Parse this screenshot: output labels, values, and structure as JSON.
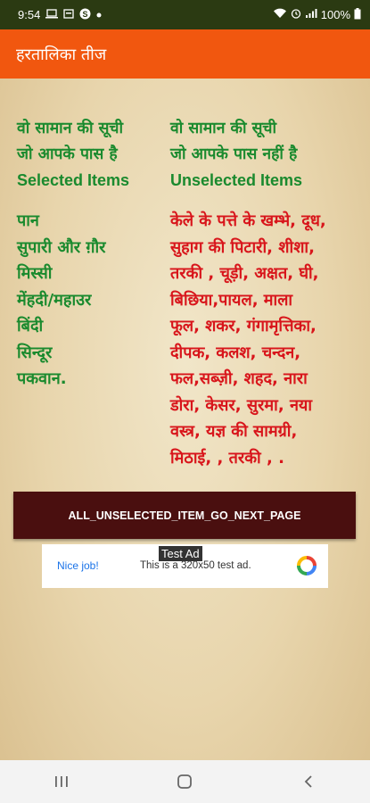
{
  "status_bar": {
    "time": "9:54",
    "battery": "100%",
    "icons": [
      "laptop-icon",
      "card-icon",
      "skype-icon",
      "dot-icon",
      "wifi-icon",
      "alarm-icon",
      "signal-icon",
      "battery-icon"
    ]
  },
  "app_bar": {
    "title": "हरतालिका तीज"
  },
  "left_column": {
    "heading_line1": "वो सामान की सूची",
    "heading_line2": "जो आपके पास है",
    "heading_en": "Selected Items",
    "items": [
      "पान",
      "सुपारी और ग़ौर",
      "मिस्सी",
      "मेंहदी/महाउर",
      "बिंदी",
      "सिन्दूर",
      "पकवान."
    ]
  },
  "right_column": {
    "heading_line1": "वो सामान की सूची",
    "heading_line2": "जो आपके पास नहीं है",
    "heading_en": "Unselected Items",
    "lines": [
      "केले के पत्ते के खम्भे, दूध,",
      "सुहाग की पिटारी, शीशा,",
      "तरकी , चूड़ी, अक्षत, घी,",
      "बिछिया,पायल, माला",
      "फूल, शकर, गंगामृत्तिका,",
      "दीपक, कलश, चन्दन,",
      "फल,सब्ज़ी, शहद, नारा",
      "डोरा, केसर, सुरमा, नया",
      "वस्त्र, यज्ञ की सामग्री,",
      "मिठाई, , तरकी , ."
    ]
  },
  "next_button": {
    "label": "ALL_UNSELECTED_ITEM_GO_NEXT_PAGE"
  },
  "ad": {
    "tag": "Test Ad",
    "nice": "Nice job!",
    "description": "This is a 320x50 test ad."
  },
  "colors": {
    "status_bar": "#2b3a12",
    "app_bar": "#f1570f",
    "selected_text": "#1a8a2e",
    "unselected_text": "#d8151b",
    "button_bg": "#4a0f0f"
  }
}
